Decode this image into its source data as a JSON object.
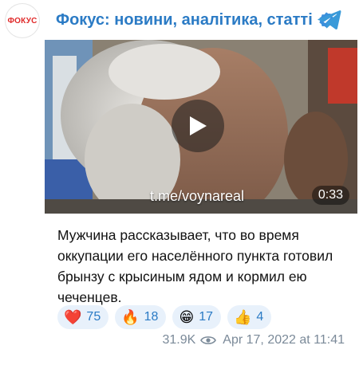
{
  "avatar": {
    "label": "ФОКУС"
  },
  "channel": {
    "name": "Фокус: новини, аналітика, статті"
  },
  "icons": {
    "avatar": "fokus-logo",
    "verified": "verified-badge-icon",
    "telegram": "telegram-icon",
    "play": "play-icon",
    "views": "eye-icon"
  },
  "video": {
    "watermark": "t.me/voynareal",
    "duration": "0:33"
  },
  "message": {
    "text": "Мужчина рассказывает, что во время оккупации его населённого пункта готовил брынзу с крысиным ядом и кормил ею чеченцев."
  },
  "reactions": [
    {
      "emoji": "❤️",
      "count": "75"
    },
    {
      "emoji": "🔥",
      "count": "18"
    },
    {
      "emoji": "😁",
      "count": "17"
    },
    {
      "emoji": "👍",
      "count": "4"
    }
  ],
  "meta": {
    "views": "31.9K",
    "timestamp": "Apr 17, 2022 at 11:41"
  },
  "colors": {
    "accent": "#2b7bc5",
    "reaction_bg": "#e8f1fb",
    "avatar_text": "#e02a2a",
    "meta_text": "#7b8a99"
  }
}
